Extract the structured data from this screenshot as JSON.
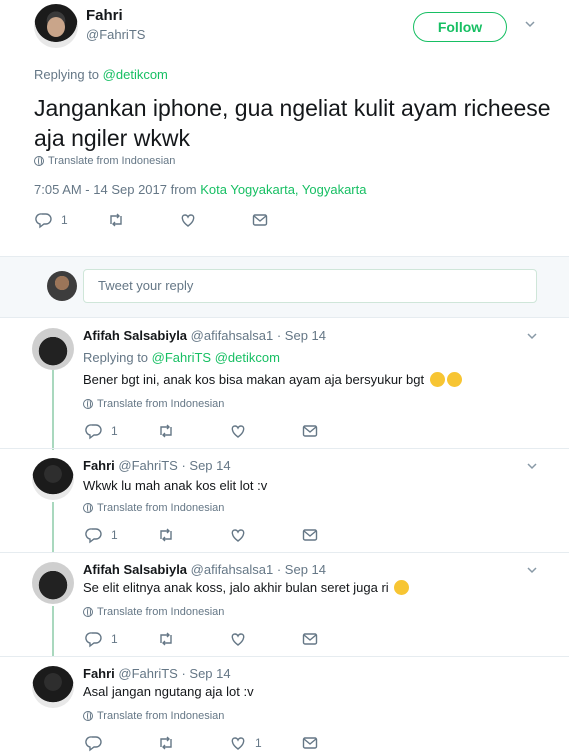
{
  "main_tweet": {
    "name": "Fahri",
    "handle": "@FahriTS",
    "follow_label": "Follow",
    "replying_prefix": "Replying to",
    "replying_to": "@detikcom",
    "text": "Jangankan iphone, gua ngeliat kulit ayam richeese aja ngiler wkwk",
    "translate": "Translate from Indonesian",
    "timestamp": "7:05 AM - 14 Sep 2017 from",
    "location": "Kota Yogyakarta, Yogyakarta",
    "reply_count": "1"
  },
  "reply_bar": {
    "placeholder": "Tweet your reply"
  },
  "replies": [
    {
      "name": "Afifah Salsabiyla",
      "meta": "@afifahsalsa1 · Sep 14",
      "replying_prefix": "Replying to",
      "replying_to": "@FahriTS @detikcom",
      "text": "Bener bgt ini, anak kos bisa makan ayam aja bersyukur bgt",
      "translate": "Translate from Indonesian",
      "reply_count": "1",
      "like_count": ""
    },
    {
      "name": "Fahri",
      "meta": "@FahriTS · Sep 14",
      "text": "Wkwk lu mah anak kos elit lot :v",
      "translate": "Translate from Indonesian",
      "reply_count": "1",
      "like_count": ""
    },
    {
      "name": "Afifah Salsabiyla",
      "meta": "@afifahsalsa1 · Sep 14",
      "text": "Se elit elitnya anak koss, jalo akhir bulan seret juga ri",
      "translate": "Translate from Indonesian",
      "reply_count": "1",
      "like_count": ""
    },
    {
      "name": "Fahri",
      "meta": "@FahriTS · Sep 14",
      "text": "Asal jangan ngutang aja lot :v",
      "translate": "Translate from Indonesian",
      "reply_count": "",
      "like_count": "1"
    }
  ],
  "colors": {
    "accent": "#17bf63",
    "muted": "#657786",
    "text": "#14171a",
    "thread_line": "#a9d8be"
  },
  "icons": [
    "chevron-down-icon",
    "globe-icon",
    "reply-icon",
    "retweet-icon",
    "like-icon",
    "dm-icon",
    "emoji-icon"
  ]
}
